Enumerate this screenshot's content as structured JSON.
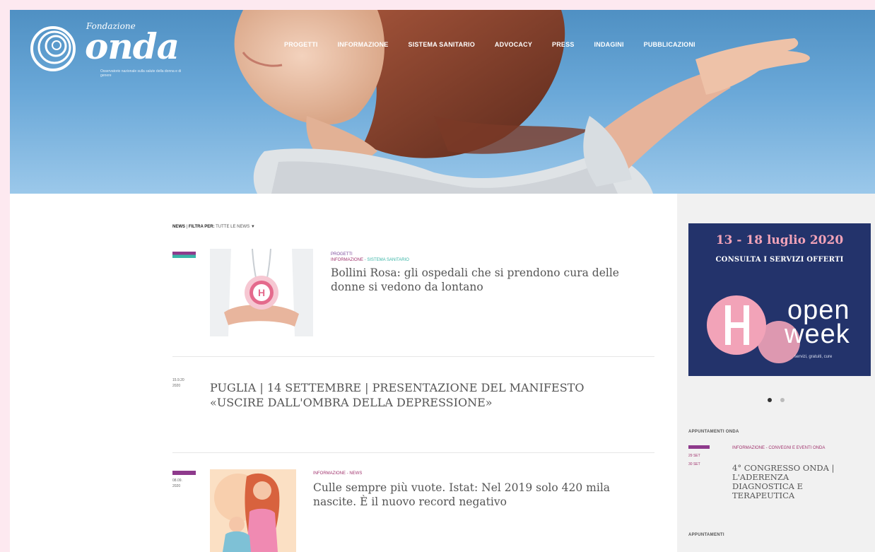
{
  "brand": {
    "prefix": "Fondazione",
    "name": "onda",
    "tagline": "Osservatorio nazionale sulla salute della donna e di genere"
  },
  "nav": {
    "items": [
      {
        "label": "PROGETTI"
      },
      {
        "label": "INFORMAZIONE"
      },
      {
        "label": "SISTEMA SANITARIO"
      },
      {
        "label": "ADVOCACY"
      },
      {
        "label": "PRESS"
      },
      {
        "label": "INDAGINI"
      },
      {
        "label": "PUBBLICAZIONI"
      }
    ]
  },
  "filter": {
    "section": "NEWS",
    "separator": "|",
    "label": "FILTRA PER:",
    "value": "TUTTE LE NEWS"
  },
  "posts": [
    {
      "categories": [
        "PROGETTI"
      ],
      "categories_line2": [
        "INFORMAZIONE",
        "SISTEMA SANITARIO"
      ],
      "title": "Bollini Rosa: gli ospedali che si prendono cura delle donne si vedono da lontano",
      "date": ""
    },
    {
      "date_line1": "15.9.20",
      "date_line2": "2020",
      "title": "PUGLIA | 14 SETTEMBRE | PRESENTAZIONE DEL MANIFESTO «USCIRE DALL'OMBRA DELLA DEPRESSIONE»"
    },
    {
      "date_line1": "08.09.",
      "date_line2": "2020",
      "categories": [
        "INFORMAZIONE",
        "NEWS"
      ],
      "title": "Culle sempre più vuote. Istat: Nel 2019 solo 420 mila nascite. È il nuovo record negativo"
    }
  ],
  "sidebar": {
    "banner": {
      "dates": "13 - 18 luglio 2020",
      "cta": "CONSULTA I SERVIZI OFFERTI",
      "open": "open",
      "week": "week",
      "sub": "servizi, gratuiti, cure"
    },
    "appointments_title": "APPUNTAMENTI ONDA",
    "event": {
      "categories": "INFORMAZIONE - CONVEGNI E EVENTI ONDA",
      "date_from": "29 SET",
      "date_to": "30 SET",
      "title": "4° CONGRESSO ONDA | L'ADERENZA DIAGNOSTICA E TERAPEUTICA"
    },
    "appointments2_title": "APPUNTAMENTI"
  },
  "colors": {
    "accent_purple": "#8e3a8c",
    "accent_teal": "#3ab5a7",
    "banner_navy": "#23336b",
    "banner_pink": "#f2a3b8"
  }
}
